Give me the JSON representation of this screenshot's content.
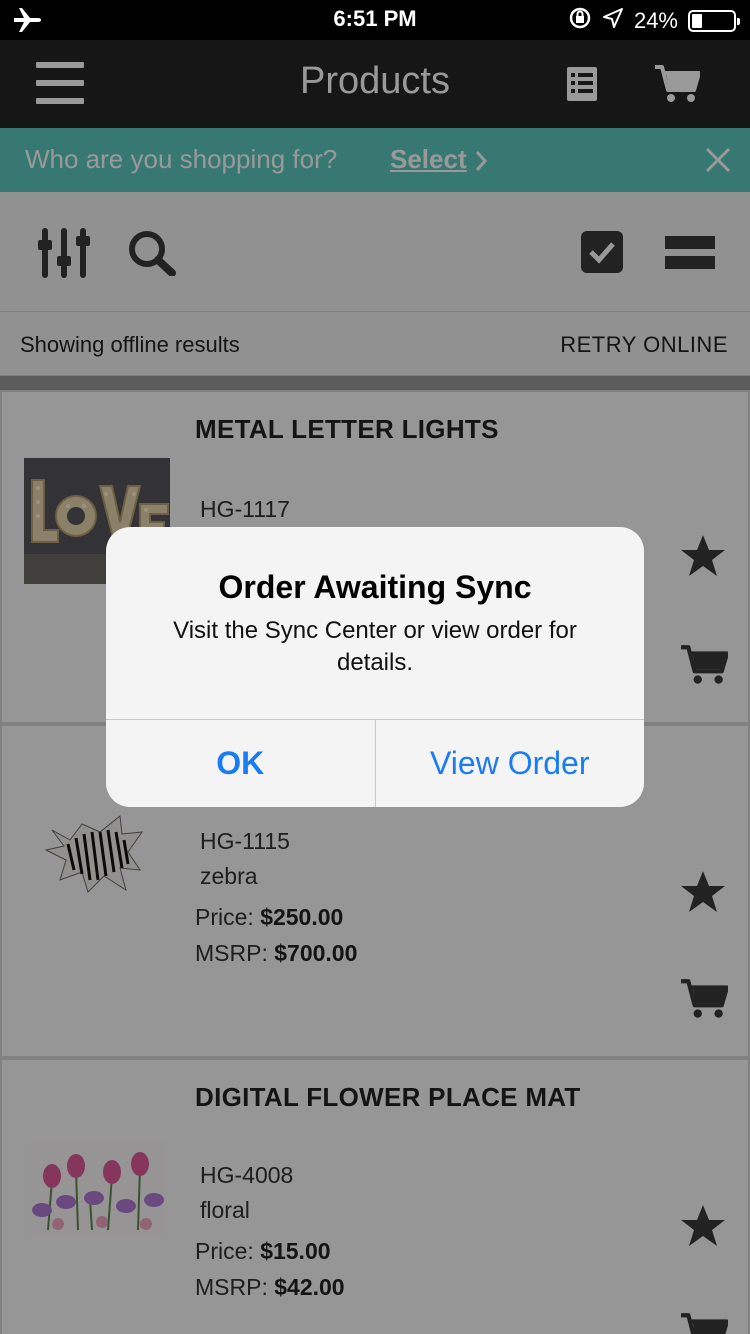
{
  "status_bar": {
    "time": "6:51 PM",
    "battery": "24%",
    "battery_level": 0.24
  },
  "nav": {
    "title": "Products"
  },
  "shopper_banner": {
    "prompt": "Who are you shopping for?",
    "select_label": "Select"
  },
  "offline": {
    "message": "Showing offline results",
    "retry_label": "RETRY ONLINE"
  },
  "products": [
    {
      "name": "METAL LETTER LIGHTS",
      "sku": "HG-1117",
      "variant": "",
      "price_label": "",
      "price": "",
      "msrp_label": "",
      "msrp": "",
      "image": "love-marquee-letters"
    },
    {
      "name": "",
      "sku": "HG-1115",
      "variant": "zebra",
      "price_label": "Price: ",
      "price": "$250.00",
      "msrp_label": "MSRP: ",
      "msrp": "$700.00",
      "image": "zebra-hide-rug"
    },
    {
      "name": "DIGITAL FLOWER PLACE MAT",
      "sku": "HG-4008",
      "variant": "floral",
      "price_label": "Price: ",
      "price": "$15.00",
      "msrp_label": "MSRP: ",
      "msrp": "$42.00",
      "image": "floral-place-mat"
    }
  ],
  "alert": {
    "title": "Order Awaiting Sync",
    "message": "Visit the Sync Center or view order for details.",
    "ok_label": "OK",
    "view_order_label": "View Order"
  },
  "icons": {
    "airplane": "airplane-icon",
    "location": "location-arrow-icon",
    "lock": "rotation-lock-icon",
    "menu": "hamburger-menu-icon",
    "list": "list-icon",
    "cart": "cart-icon",
    "filter": "sliders-icon",
    "search": "search-icon",
    "checkbox": "checkbox-icon",
    "layout": "list-layout-icon",
    "star": "star-icon",
    "chevron": "chevron-right-icon",
    "close": "close-icon"
  },
  "colors": {
    "accent": "#5ec9c0",
    "nav": "#262626",
    "alert_button": "#1a7cf4"
  }
}
